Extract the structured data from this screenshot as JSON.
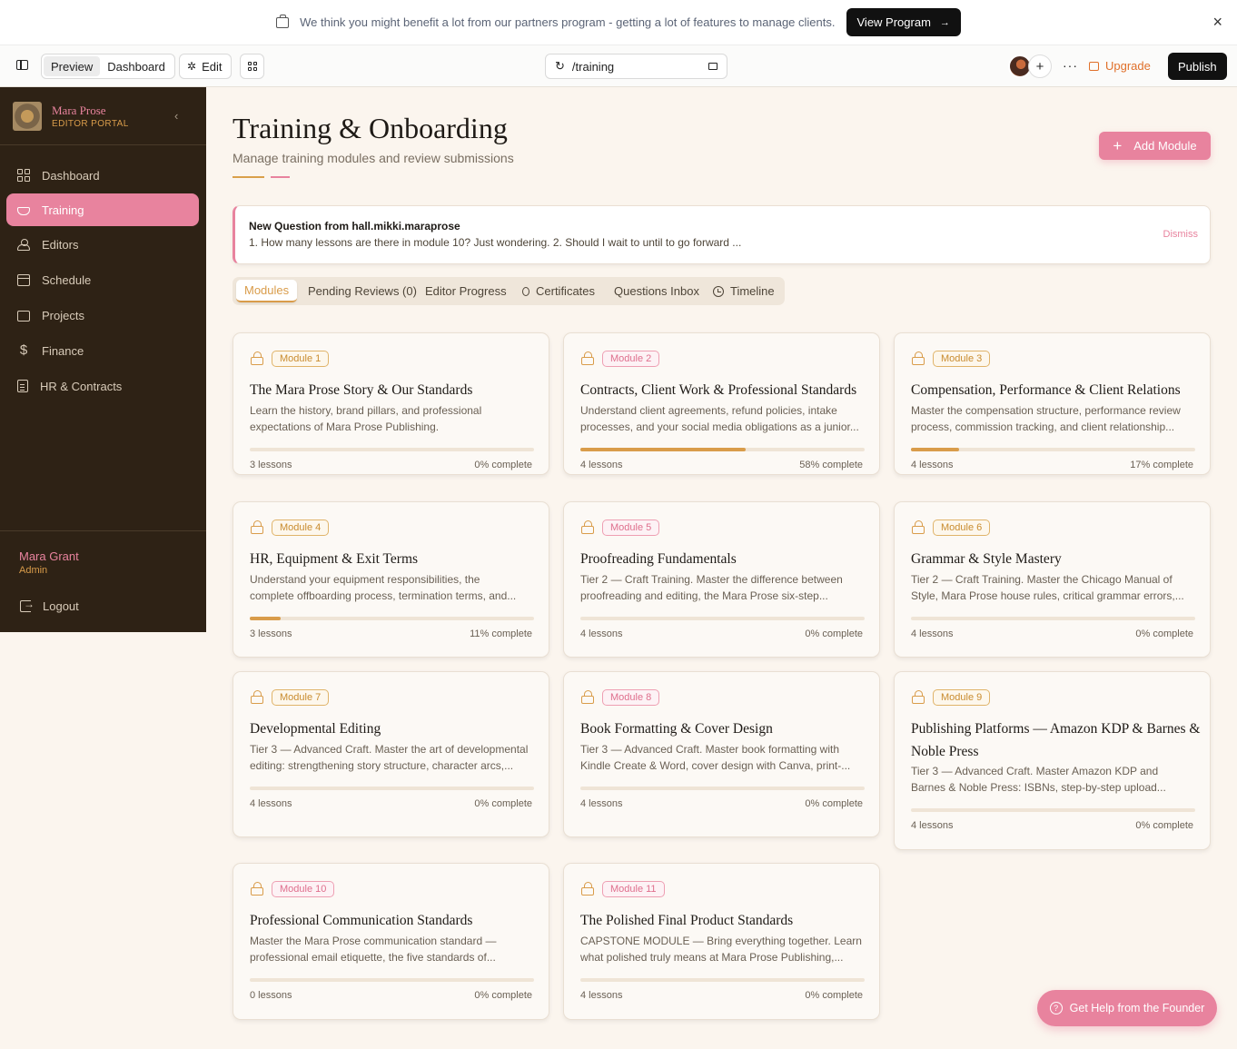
{
  "banner": {
    "message": "We think you might benefit a lot from our partners program - getting a lot of features to manage clients.",
    "button_label": "View Program",
    "button_arrow": "→",
    "close": "×"
  },
  "toolbar": {
    "preview_label": "Preview",
    "dashboard_label": "Dashboard",
    "edit_label": "Edit",
    "url": "/training",
    "more": "···",
    "upgrade_label": "Upgrade",
    "publish_label": "Publish"
  },
  "sidebar": {
    "brand_name": "Mara Prose",
    "brand_sub": "EDITOR PORTAL",
    "collapse": "‹",
    "items": [
      {
        "label": "Dashboard",
        "icon": "grid-icon"
      },
      {
        "label": "Training",
        "icon": "graduation-cap-icon"
      },
      {
        "label": "Editors",
        "icon": "users-icon"
      },
      {
        "label": "Schedule",
        "icon": "calendar-icon"
      },
      {
        "label": "Projects",
        "icon": "folder-icon"
      },
      {
        "label": "Finance",
        "icon": "dollar-icon"
      },
      {
        "label": "HR & Contracts",
        "icon": "document-icon"
      }
    ],
    "active_item": "Training",
    "user_name": "Mara Grant",
    "user_role": "Admin",
    "logout_label": "Logout"
  },
  "page": {
    "title": "Training & Onboarding",
    "subtitle": "Manage training modules and review submissions",
    "add_button": "Add Module",
    "add_plus": "+"
  },
  "notice": {
    "title": "New Question from hall.mikki.maraprose",
    "body": "1. How many lessons are there in module 10? Just wondering. 2. Should I wait to until to go forward ...",
    "dismiss": "Dismiss"
  },
  "tabs": [
    {
      "label": "Modules",
      "active": true
    },
    {
      "label": "Pending Reviews (0)"
    },
    {
      "label": "Editor Progress"
    },
    {
      "label": "Certificates",
      "icon": "award-icon"
    },
    {
      "label": "Questions Inbox"
    },
    {
      "label": "Timeline",
      "icon": "clock-icon"
    }
  ],
  "modules": [
    {
      "badge": "Module 1",
      "title": "The Mara Prose Story & Our Standards",
      "desc1": "Learn the history, brand pillars, and professional",
      "desc2": "expectations of Mara Prose Publishing.",
      "lessons": "3 lessons",
      "progress_label": "0% complete",
      "progress": 0
    },
    {
      "badge": "Module 2",
      "title": "Contracts, Client Work & Professional Standards",
      "desc1": "Understand client agreements, refund policies, intake",
      "desc2": "processes, and your social media obligations as a junior...",
      "lessons": "4 lessons",
      "progress_label": "58% complete",
      "progress": 58
    },
    {
      "badge": "Module 3",
      "title": "Compensation, Performance & Client Relations",
      "desc1": "Master the compensation structure, performance review",
      "desc2": "process, commission tracking, and client relationship...",
      "lessons": "4 lessons",
      "progress_label": "17% complete",
      "progress": 17
    },
    {
      "badge": "Module 4",
      "title": "HR, Equipment & Exit Terms",
      "desc1": "Understand your equipment responsibilities, the",
      "desc2": "complete offboarding process, termination terms, and...",
      "lessons": "3 lessons",
      "progress_label": "11% complete",
      "progress": 11
    },
    {
      "badge": "Module 5",
      "title": "Proofreading Fundamentals",
      "desc1": "Tier 2 — Craft Training. Master the difference between",
      "desc2": "proofreading and editing, the Mara Prose six-step...",
      "lessons": "4 lessons",
      "progress_label": "0% complete",
      "progress": 0
    },
    {
      "badge": "Module 6",
      "title": "Grammar & Style Mastery",
      "desc1": "Tier 2 — Craft Training. Master the Chicago Manual of",
      "desc2": "Style, Mara Prose house rules, critical grammar errors,...",
      "lessons": "4 lessons",
      "progress_label": "0% complete",
      "progress": 0
    },
    {
      "badge": "Module 7",
      "title": "Developmental Editing",
      "desc1": "Tier 3 — Advanced Craft. Master the art of developmental",
      "desc2": "editing: strengthening story structure, character arcs,...",
      "lessons": "4 lessons",
      "progress_label": "0% complete",
      "progress": 0
    },
    {
      "badge": "Module 8",
      "title": "Book Formatting & Cover Design",
      "desc1": "Tier 3 — Advanced Craft. Master book formatting with",
      "desc2": "Kindle Create & Word, cover design with Canva, print-...",
      "lessons": "4 lessons",
      "progress_label": "0% complete",
      "progress": 0
    },
    {
      "badge": "Module 9",
      "title": "Publishing Platforms — Amazon KDP & Barnes & Noble Press",
      "desc1": "Tier 3 — Advanced Craft. Master Amazon KDP and",
      "desc2": "Barnes & Noble Press: ISBNs, step-by-step upload...",
      "lessons": "4 lessons",
      "progress_label": "0% complete",
      "progress": 0
    },
    {
      "badge": "Module 10",
      "title": "Professional Communication Standards",
      "desc1": "Master the Mara Prose communication standard —",
      "desc2": "professional email etiquette, the five standards of...",
      "lessons": "0 lessons",
      "progress_label": "0% complete",
      "progress": 0
    },
    {
      "badge": "Module 11",
      "title": "The Polished Final Product Standards",
      "desc1": "CAPSTONE MODULE — Bring everything together. Learn",
      "desc2": "what polished truly means at Mara Prose Publishing,...",
      "lessons": "4 lessons",
      "progress_label": "0% complete",
      "progress": 0
    }
  ],
  "help_button": "Get Help from the Founder",
  "colors": {
    "accent_pink": "#e8839e",
    "accent_gold": "#d99c4a",
    "sidebar_bg": "#2e2215",
    "page_bg": "#fbf5ee"
  }
}
